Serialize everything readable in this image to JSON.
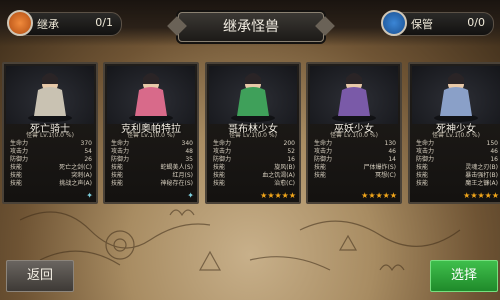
{
  "header": {
    "left_label": "继承",
    "left_count": "0/1",
    "title": "继承怪兽",
    "right_label": "保管",
    "right_count": "0/0"
  },
  "stat_labels": {
    "hp": "生命力",
    "atk": "攻击力",
    "def": "防御力",
    "skill": "技能"
  },
  "cards": [
    {
      "name": "死亡骑士",
      "level": "怪兽 Lv.1(0.0 %)",
      "hp": "370",
      "atk": "54",
      "def": "26",
      "skills": [
        "死亡之剑(C)",
        "突刺(A)",
        "挑战之声(A)"
      ],
      "rarity": "✦",
      "stars": 0
    },
    {
      "name": "克利奥帕特拉",
      "level": "怪兽 Lv.1(0.0 %)",
      "hp": "340",
      "atk": "48",
      "def": "35",
      "skills": [
        "蛇蝎美人(S)",
        "红月(S)",
        "神秘存在(S)"
      ],
      "rarity": "✦",
      "stars": 0
    },
    {
      "name": "哥布林少女",
      "level": "怪兽 Lv.1(0.0 %)",
      "hp": "200",
      "atk": "52",
      "def": "16",
      "skills": [
        "旋风(B)",
        "血之饥渴(A)",
        "治愈(C)"
      ],
      "rarity": "",
      "stars": 5
    },
    {
      "name": "巫妖少女",
      "level": "怪兽 Lv.1(0.0 %)",
      "hp": "130",
      "atk": "46",
      "def": "14",
      "skills": [
        "尸体爆炸(S)",
        "冥想(C)"
      ],
      "rarity": "",
      "stars": 5
    },
    {
      "name": "死神少女",
      "level": "怪兽 Lv.1(0.0 %)",
      "hp": "150",
      "atk": "46",
      "def": "16",
      "skills": [
        "灵魂之刃(B)",
        "暴击强打(B)",
        "魔王之镰(A)"
      ],
      "rarity": "",
      "stars": 5
    }
  ],
  "buttons": {
    "back": "返回",
    "select": "选择"
  },
  "colors": {
    "star": "#f2a61a",
    "select_button": "#2fa83c",
    "back_button": "#55504a"
  }
}
